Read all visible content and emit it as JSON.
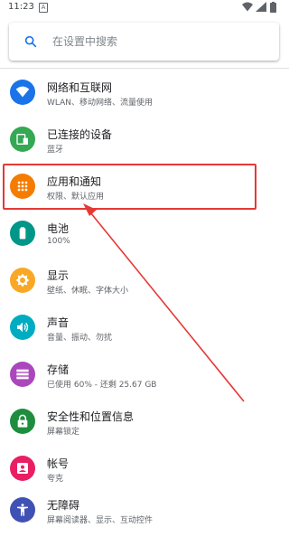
{
  "status": {
    "time": "11:23",
    "notification_badge": "A"
  },
  "search": {
    "placeholder": "在设置中搜索"
  },
  "settings": [
    {
      "title": "网络和互联网",
      "subtitle": "WLAN、移动网络、流量使用",
      "color": "#1a73e8",
      "icon": "wifi-icon"
    },
    {
      "title": "已连接的设备",
      "subtitle": "蓝牙",
      "color": "#34a853",
      "icon": "devices-icon"
    },
    {
      "title": "应用和通知",
      "subtitle": "权限、默认应用",
      "color": "#f57c00",
      "icon": "apps-icon"
    },
    {
      "title": "电池",
      "subtitle": "100%",
      "color": "#009688",
      "icon": "battery-icon"
    },
    {
      "title": "显示",
      "subtitle": "壁纸、休眠、字体大小",
      "color": "#f9a825",
      "icon": "brightness-icon"
    },
    {
      "title": "声音",
      "subtitle": "音量、振动、勿扰",
      "color": "#00acc1",
      "icon": "volume-icon"
    },
    {
      "title": "存储",
      "subtitle": "已使用 60% - 还剩 25.67 GB",
      "color": "#ab47bc",
      "icon": "storage-icon"
    },
    {
      "title": "安全性和位置信息",
      "subtitle": "屏幕锁定",
      "color": "#1e8e3e",
      "icon": "lock-icon"
    },
    {
      "title": "帐号",
      "subtitle": "夸克",
      "color": "#e91e63",
      "icon": "account-icon"
    },
    {
      "title": "无障碍",
      "subtitle": "屏幕阅读器、显示、互动控件",
      "color": "#3f51b5",
      "icon": "accessibility-icon"
    }
  ],
  "annotation": {
    "highlight_color": "#e53935"
  }
}
